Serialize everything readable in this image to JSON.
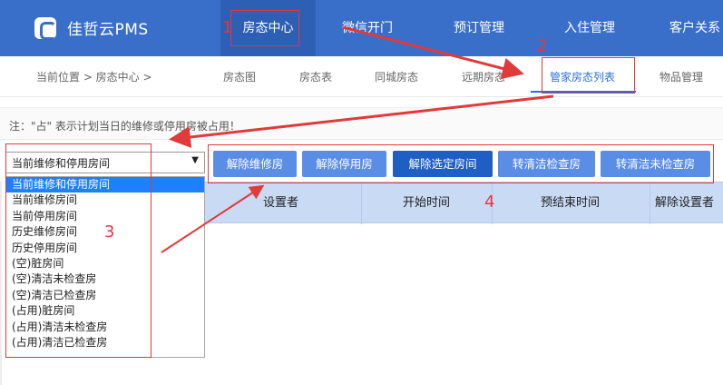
{
  "brand": {
    "name": "佳哲云PMS"
  },
  "nav": {
    "items": [
      {
        "label": "房态中心"
      },
      {
        "label": "微信开门"
      },
      {
        "label": "预订管理"
      },
      {
        "label": "入住管理"
      },
      {
        "label": "客户关系"
      }
    ]
  },
  "breadcrumb": {
    "text": "当前位置 > 房态中心 >"
  },
  "subtabs": [
    {
      "label": "房态图"
    },
    {
      "label": "房态表"
    },
    {
      "label": "同城房态"
    },
    {
      "label": "远期房态"
    },
    {
      "label": "管家房态列表"
    },
    {
      "label": "物品管理"
    }
  ],
  "note": {
    "text": "注：\"占\" 表示计划当日的维修或停用房被占用！"
  },
  "filter": {
    "selected": "当前维修和停用房间",
    "options": [
      "当前维修和停用房间",
      "当前维修房间",
      "当前停用房间",
      "历史维修房间",
      "历史停用房间",
      "(空)脏房间",
      "(空)清洁未检查房",
      "(空)清洁已检查房",
      "(占用)脏房间",
      "(占用)清洁未检查房",
      "(占用)清洁已检查房"
    ]
  },
  "actions": {
    "release_repair": "解除维修房",
    "release_stop": "解除停用房",
    "release_selected": "解除选定房间",
    "to_clean_checked": "转清洁检查房",
    "to_clean_unchecked": "转清洁未检查房"
  },
  "table": {
    "headers": [
      "设置者",
      "开始时间",
      "预结束时间",
      "解除设置者"
    ]
  },
  "annotations": [
    "1",
    "2",
    "3",
    "4"
  ],
  "colors": {
    "nav_bg": "#3a6fc9",
    "accent": "#2d6fd6",
    "annotation": "#e03a3a"
  }
}
